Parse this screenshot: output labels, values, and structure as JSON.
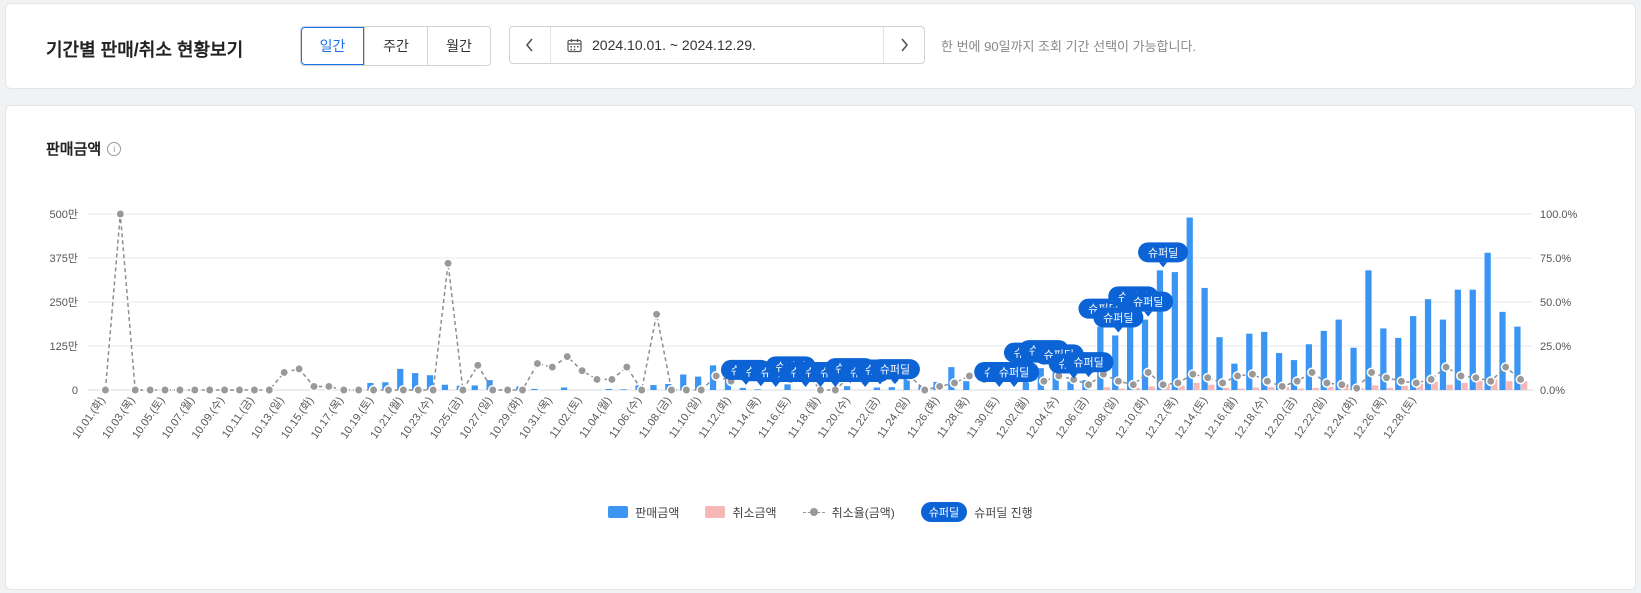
{
  "header": {
    "title": "기간별 판매/취소 현황보기",
    "period_tabs": [
      {
        "label": "일간",
        "active": true
      },
      {
        "label": "주간",
        "active": false
      },
      {
        "label": "월간",
        "active": false
      }
    ],
    "date_range": "2024.10.01. ~ 2024.12.29.",
    "hint": "한 번에 90일까지 조회 기간 선택이 가능합니다."
  },
  "chart_section": {
    "title": "판매금액",
    "info_icon": "info-icon"
  },
  "colors": {
    "sales": "#3b96f3",
    "cancel": "#f6b7b7",
    "rate": "#999999",
    "superdeal": "#0b63d6"
  },
  "chart_data": {
    "type": "bar",
    "start_date": "2024-10-01",
    "categories": [
      "10.01.(화)",
      "10.03.(목)",
      "10.05.(토)",
      "10.07.(월)",
      "10.09.(수)",
      "10.11.(금)",
      "10.13.(일)",
      "10.15.(화)",
      "10.17.(목)",
      "10.19.(토)",
      "10.21.(월)",
      "10.23.(수)",
      "10.25.(금)",
      "10.27.(일)",
      "10.29.(화)",
      "10.31.(목)",
      "11.02.(토)",
      "11.04.(월)",
      "11.06.(수)",
      "11.08.(금)",
      "11.10.(일)",
      "11.12.(화)",
      "11.14.(목)",
      "11.16.(토)",
      "11.18.(월)",
      "11.20.(수)",
      "11.22.(금)",
      "11.24.(일)",
      "11.26.(화)",
      "11.28.(목)",
      "11.30.(토)",
      "12.02.(월)",
      "12.04.(수)",
      "12.06.(금)",
      "12.08.(일)",
      "12.10.(화)",
      "12.12.(목)",
      "12.14.(토)",
      "12.16.(월)",
      "12.18.(수)",
      "12.20.(금)",
      "12.22.(일)",
      "12.24.(화)",
      "12.26.(목)",
      "12.28.(토)"
    ],
    "y_left": {
      "ticks": [
        "0",
        "125만",
        "250만",
        "375만",
        "500만"
      ],
      "ylim": [
        0,
        5000000
      ]
    },
    "y_right": {
      "ticks": [
        "0.0%",
        "25.0%",
        "50.0%",
        "75.0%",
        "100.0%"
      ],
      "ylim": [
        0,
        100
      ]
    },
    "series": [
      {
        "name": "판매금액",
        "type": "bar",
        "values": [
          0,
          0,
          0,
          0,
          0,
          0,
          0,
          0,
          0,
          0,
          0,
          0,
          0,
          0,
          0,
          0,
          0,
          0,
          200000,
          220000,
          600000,
          480000,
          420000,
          150000,
          120000,
          130000,
          280000,
          0,
          100000,
          30000,
          0,
          70000,
          0,
          0,
          30000,
          20000,
          130000,
          140000,
          170000,
          440000,
          380000,
          700000,
          380000,
          60000,
          20000,
          0,
          160000,
          0,
          0,
          0,
          110000,
          0,
          70000,
          80000,
          400000,
          120000,
          230000,
          650000,
          250000,
          0,
          0,
          0,
          550000,
          620000,
          500000,
          240000,
          280000,
          1800000,
          1550000,
          2150000,
          2000000,
          3400000,
          3350000,
          4900000,
          2900000,
          1500000,
          750000,
          1600000,
          1650000,
          1050000,
          850000,
          1300000,
          1680000,
          2000000,
          1200000,
          3400000,
          1750000,
          1480000,
          2100000,
          2580000,
          2000000,
          2850000,
          2850000,
          3900000,
          2220000,
          1800000
        ]
      },
      {
        "name": "취소금액",
        "type": "bar",
        "values": [
          0,
          0,
          0,
          0,
          0,
          0,
          0,
          0,
          0,
          0,
          0,
          0,
          0,
          0,
          0,
          0,
          0,
          0,
          0,
          0,
          0,
          0,
          0,
          0,
          0,
          0,
          0,
          0,
          0,
          0,
          0,
          0,
          0,
          0,
          0,
          0,
          0,
          0,
          0,
          0,
          0,
          0,
          0,
          0,
          0,
          0,
          0,
          0,
          0,
          0,
          0,
          0,
          0,
          0,
          0,
          0,
          0,
          0,
          0,
          0,
          0,
          0,
          0,
          0,
          0,
          0,
          0,
          80000,
          40000,
          60000,
          100000,
          180000,
          120000,
          200000,
          150000,
          60000,
          40000,
          70000,
          80000,
          90000,
          40000,
          60000,
          90000,
          170000,
          60000,
          130000,
          60000,
          120000,
          180000,
          240000,
          150000,
          200000,
          260000,
          300000,
          250000,
          250000
        ]
      },
      {
        "name": "취소율(금액)",
        "type": "line",
        "values": [
          0,
          100,
          0,
          0,
          0,
          0,
          0,
          0,
          0,
          0,
          0,
          0,
          10,
          12,
          2,
          2,
          0,
          0,
          0,
          0,
          0,
          0,
          0,
          72,
          0,
          14,
          0,
          0,
          0,
          15,
          13,
          19,
          11,
          6,
          6,
          13,
          0,
          43,
          0,
          0,
          0,
          8,
          5,
          14,
          7,
          5,
          6,
          10,
          0,
          0,
          8,
          5,
          13,
          6,
          8,
          0,
          2,
          4,
          8,
          6,
          6,
          7,
          7,
          5,
          8,
          6,
          3,
          9,
          5,
          3,
          10,
          3,
          4,
          9,
          7,
          4,
          8,
          9,
          5,
          2,
          5,
          10,
          4,
          3,
          1,
          10,
          7,
          5,
          4,
          6,
          13,
          8,
          7,
          5,
          13,
          6,
          2
        ]
      },
      {
        "name": "슈퍼딜 진행",
        "type": "badge",
        "label": "슈퍼딜"
      }
    ],
    "legend": [
      "판매금액",
      "취소금액",
      "취소율(금액)",
      "슈퍼딜 진행"
    ],
    "legend_position": "bottom",
    "grid": true
  }
}
